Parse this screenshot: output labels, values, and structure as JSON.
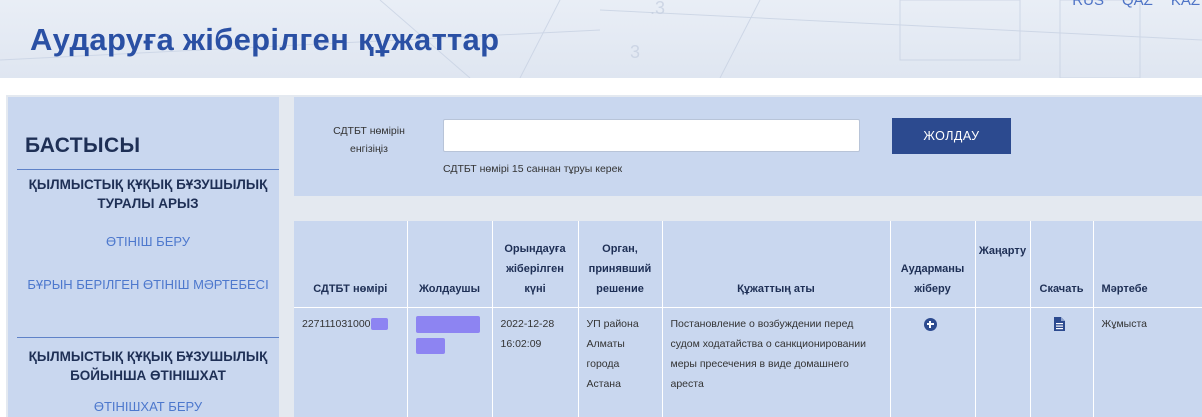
{
  "header": {
    "title": "Аударуға жіберілген құжаттар",
    "languages": [
      "RUS",
      "QAZ",
      "KAZ"
    ]
  },
  "sidebar": {
    "heading": "БАСТЫСЫ",
    "section1_title": "ҚЫЛМЫСТЫҚ ҚҰҚЫҚ БҰЗУШЫЛЫҚ ТУРАЛЫ АРЫЗ",
    "section1_links": [
      "ӨТІНІШ БЕРУ",
      "БҰРЫН БЕРІЛГЕН ӨТІНІШ МӘРТЕБЕСІ"
    ],
    "section2_title": "ҚЫЛМЫСТЫҚ ҚҰҚЫҚ БҰЗУШЫЛЫҚ БОЙЫНША ӨТІНІШХАТ",
    "section2_links": [
      "ӨТІНІШХАТ БЕРУ"
    ]
  },
  "search": {
    "label": "СДТБТ нөмірін енгізіңіз",
    "value": "",
    "placeholder": "",
    "hint": "СДТБТ нөмірі 15 саннан тұруы керек",
    "button": "ЖОЛДАУ"
  },
  "table": {
    "headers": {
      "number": "СДТБТ нөмірі",
      "sender": "Жолдаушы",
      "date": "Орындауға жіберілген күні",
      "authority": "Орган, принявший решение",
      "doc_name": "Құжаттың аты",
      "send_translator": "Аударманы жіберу",
      "update": "Жаңарту",
      "download": "Скачать",
      "status": "Мәртебе"
    },
    "rows": [
      {
        "number": "227111031000",
        "date": "2022-12-28 16:02:09",
        "authority": "УП района Алматы города Астана",
        "doc_name": "Постановление о возбуждении перед судом ходатайства о санкционировании меры пресечения в виде домашнего ареста",
        "status": "Жұмыста"
      }
    ]
  },
  "icons": {
    "send_translator": "circle-plus-icon",
    "download": "document-icon"
  },
  "colors": {
    "title_blue": "#2a50a4",
    "panel_blue": "#c9d7ef",
    "button_navy": "#2c4a8f",
    "link_blue": "#4d78cd",
    "redaction": "#8d84f2"
  }
}
